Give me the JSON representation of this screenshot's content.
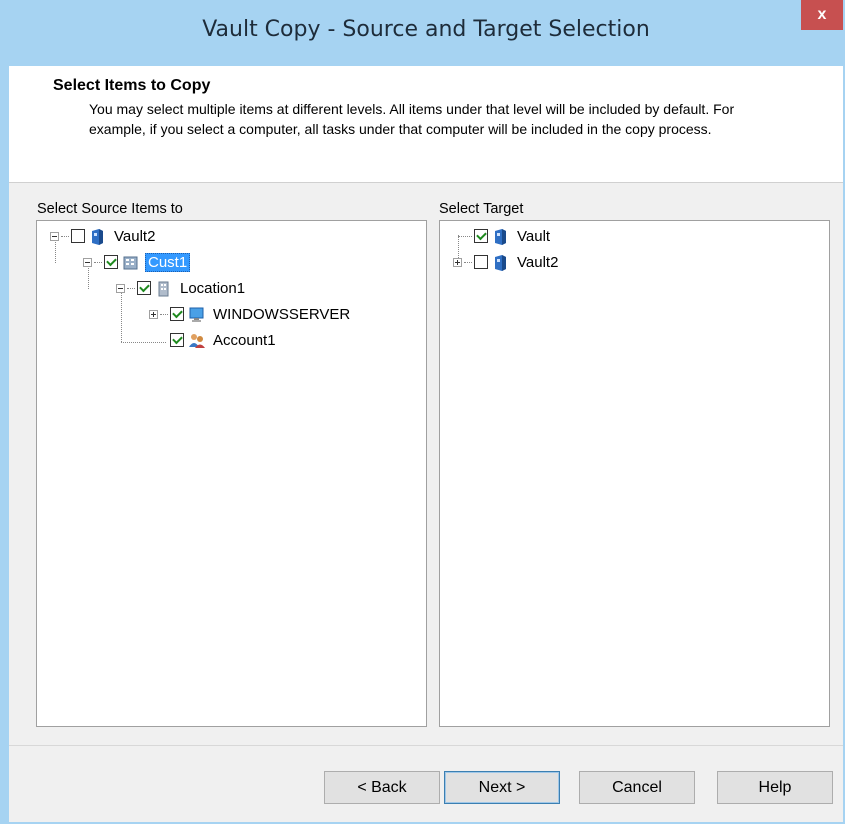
{
  "window": {
    "title": "Vault Copy - Source and Target Selection",
    "close_label": "x"
  },
  "header": {
    "title": "Select Items to Copy",
    "description": "You may select multiple items at different levels.  All items under that level will be included by default. For example, if you select a computer, all tasks under that computer will be included in the copy process."
  },
  "source": {
    "label": "Select Source Items to",
    "items": [
      {
        "label": "Vault2",
        "checked": false,
        "expander": "minus",
        "icon": "vault-icon"
      },
      {
        "label": "Cust1",
        "checked": true,
        "expander": "minus",
        "icon": "customer-icon",
        "selected": true
      },
      {
        "label": "Location1",
        "checked": true,
        "expander": "minus",
        "icon": "location-icon"
      },
      {
        "label": "WINDOWSSERVER",
        "checked": true,
        "expander": "plus",
        "icon": "computer-icon"
      },
      {
        "label": "Account1",
        "checked": true,
        "expander": "none",
        "icon": "account-icon"
      }
    ]
  },
  "target": {
    "label": "Select Target",
    "items": [
      {
        "label": "Vault",
        "checked": true,
        "expander": "none",
        "icon": "vault-icon"
      },
      {
        "label": "Vault2",
        "checked": false,
        "expander": "plus",
        "icon": "vault-icon"
      }
    ]
  },
  "buttons": {
    "back": "< Back",
    "next": "Next >",
    "cancel": "Cancel",
    "help": "Help"
  }
}
